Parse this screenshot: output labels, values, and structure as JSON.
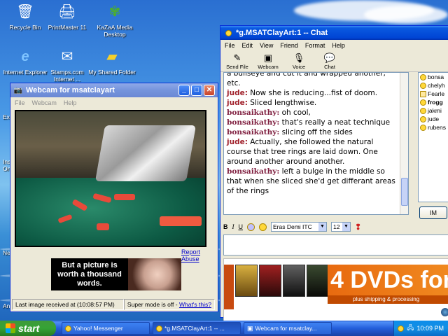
{
  "desktop": {
    "icons": [
      {
        "label": "Recycle Bin",
        "icon": "recycle-bin-icon"
      },
      {
        "label": "PrintMaster 11",
        "icon": "printmaster-icon"
      },
      {
        "label": "KaZaA Media Desktop",
        "icon": "kazaa-icon"
      },
      {
        "label": "Internet Explorer",
        "icon": "internet-explorer-icon"
      },
      {
        "label": "Stamps.com Internet ...",
        "icon": "stamps-icon"
      },
      {
        "label": "My Shared Folder",
        "icon": "shared-folder-icon"
      }
    ],
    "cut_labels": [
      "Exp",
      "Ins",
      "On",
      "Ne",
      "An"
    ]
  },
  "webcam": {
    "title": "Webcam for msatclayart",
    "menu": [
      "File",
      "Webcam",
      "Help"
    ],
    "report_abuse": "Report Abuse",
    "ad_text": "But a picture is worth a thousand words.",
    "status_last": "Last image received at (10:08:57 PM)",
    "status_super": "Super mode is off -",
    "status_whats": "What's this?"
  },
  "chat": {
    "title": "*g.MSATClayArt:1 -- Chat",
    "menu": [
      "File",
      "Edit",
      "View",
      "Friend",
      "Format",
      "Help"
    ],
    "tools": [
      {
        "label": "Send File",
        "icon": "send-file-icon"
      },
      {
        "label": "Webcam",
        "icon": "webcam-icon"
      },
      {
        "label": "Voice",
        "icon": "microphone-icon"
      },
      {
        "label": "Chat",
        "icon": "chat-bubbles-icon"
      }
    ],
    "messages": [
      {
        "nick": "",
        "text": "a bullseye and cut it and wrapped another, etc."
      },
      {
        "nick": "jude:",
        "text": "Now she is reducing...fist of doom.",
        "who": "jude"
      },
      {
        "nick": "jude:",
        "text": "Sliced lengthwise.",
        "who": "jude"
      },
      {
        "nick": "bonsaikathy:",
        "text": "oh cool,",
        "who": "bons"
      },
      {
        "nick": "bonsaikathy:",
        "text": "that's really a neat technique",
        "who": "bons"
      },
      {
        "nick": "bonsaikathy:",
        "text": "slicing off the sides",
        "who": "bons"
      },
      {
        "nick": "jude:",
        "text": "Actually, she followed the natural course that tree rings are laid down. One around another around another.",
        "who": "jude"
      },
      {
        "nick": "bonsaikathy:",
        "text": "left a bulge in the middle so that when she sliced she'd get differant areas of the rings",
        "who": "bons"
      }
    ],
    "roster": [
      "bonsa",
      "chelyh",
      "Fearle",
      "frogg",
      "jakmi",
      "jude",
      "rubens"
    ],
    "im_button": "IM",
    "format": {
      "bold": "B",
      "italic": "I",
      "underline": "U",
      "font": "Eras Demi ITC",
      "size": "12"
    },
    "dvd_ad": {
      "big": "4 DVDs for",
      "sub": "plus shipping & processing"
    }
  },
  "taskbar": {
    "start": "start",
    "tasks": [
      {
        "label": "Yahoo! Messenger",
        "icon": "yahoo-smiley-icon"
      },
      {
        "label": "*g.MSATClayArt:1 -- ...",
        "icon": "yahoo-smiley-icon"
      },
      {
        "label": "Webcam for msatclay...",
        "icon": "webcam-icon"
      }
    ],
    "clock": "10:09 PM"
  },
  "colors": {
    "xp_blue": "#0044d4",
    "start_green": "#35a335",
    "jude_nick": "#a0202a",
    "bons_nick": "#802040"
  }
}
